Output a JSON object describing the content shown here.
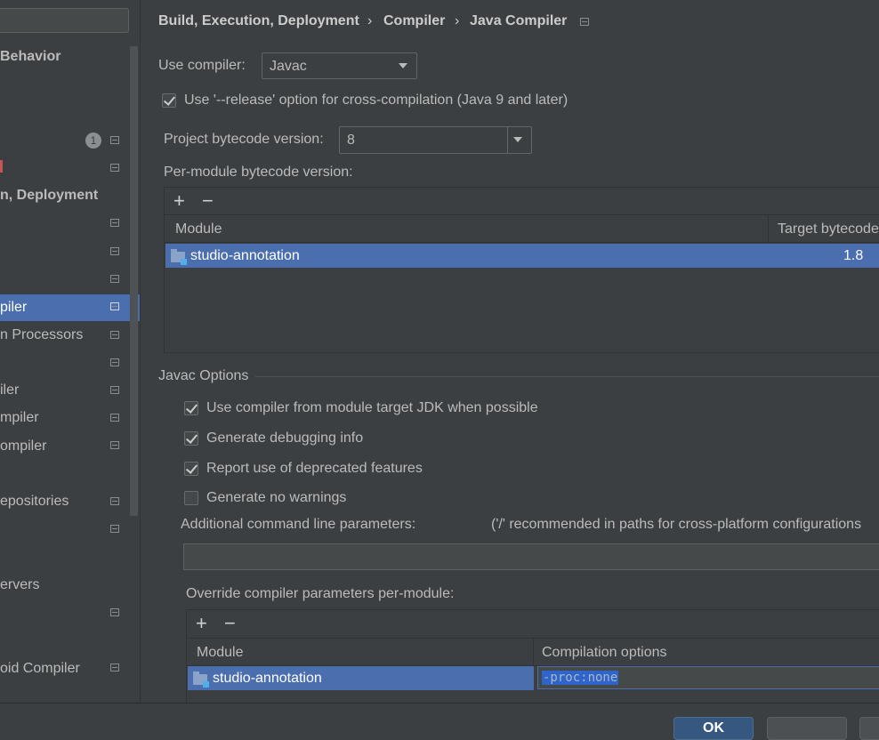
{
  "sidebar": {
    "items": [
      {
        "label": "Behavior"
      },
      {
        "label": ""
      },
      {
        "label": ""
      },
      {
        "label": "1"
      },
      {
        "label": ""
      },
      {
        "label": "n, Deployment"
      },
      {
        "label": "piler"
      },
      {
        "label": "n Processors"
      },
      {
        "label": "iler"
      },
      {
        "label": "mpiler"
      },
      {
        "label": "ompiler"
      },
      {
        "label": "epositories"
      },
      {
        "label": "ervers"
      },
      {
        "label": "oid Compiler"
      }
    ]
  },
  "breadcrumb": {
    "part1": "Build, Execution, Deployment",
    "sep": "›",
    "part2": "Compiler",
    "part3": "Java Compiler"
  },
  "compiler": {
    "label": "Use compiler:",
    "value": "Javac"
  },
  "release_option": {
    "label": "Use '--release' option for cross-compilation (Java 9 and later)",
    "checked": true
  },
  "bytecode": {
    "label": "Project bytecode version:",
    "value": "8"
  },
  "per_module": {
    "label": "Per-module bytecode version:",
    "add": "+",
    "remove": "−",
    "columns": [
      "Module",
      "Target bytecode"
    ],
    "rows": [
      {
        "module": "studio-annotation",
        "target": "1.8"
      }
    ]
  },
  "javac": {
    "section_label": "Javac Options",
    "options": [
      {
        "label": "Use compiler from module target JDK when possible",
        "checked": true
      },
      {
        "label": "Generate debugging info",
        "checked": true
      },
      {
        "label": "Report use of deprecated features",
        "checked": true
      },
      {
        "label": "Generate no warnings",
        "checked": false
      }
    ],
    "params_label": "Additional command line parameters:",
    "params_hint": "('/' recommended in paths for cross-platform configurations",
    "params_value": ""
  },
  "override": {
    "label": "Override compiler parameters per-module:",
    "add": "+",
    "remove": "−",
    "columns": [
      "Module",
      "Compilation options"
    ],
    "rows": [
      {
        "module": "studio-annotation",
        "options": "-proc:none"
      }
    ]
  },
  "buttons": {
    "ok": "OK"
  },
  "colors": {
    "selection": "#4b6eaf",
    "background": "#3c3f41"
  }
}
